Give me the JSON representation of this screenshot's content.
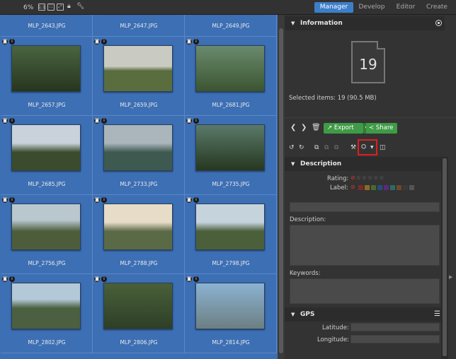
{
  "toolbar": {
    "zoom": "6%"
  },
  "tabs": [
    "Manager",
    "Develop",
    "Editor",
    "Create"
  ],
  "grid": {
    "files": [
      "MLP_2643.JPG",
      "MLP_2647.JPG",
      "MLP_2649.JPG",
      "MLP_2657.JPG",
      "MLP_2659.JPG",
      "MLP_2681.JPG",
      "MLP_2685.JPG",
      "MLP_2733.JPG",
      "MLP_2735.JPG",
      "MLP_2756.JPG",
      "MLP_2788.JPG",
      "MLP_2798.JPG",
      "MLP_2802.JPG",
      "MLP_2806.JPG",
      "MLP_2814.JPG"
    ]
  },
  "information": {
    "title": "Information",
    "count": "19",
    "selected": "Selected items: 19 (90.5 MB)"
  },
  "actions": {
    "export": "Export",
    "share": "Share"
  },
  "description": {
    "title": "Description",
    "rating_label": "Rating:",
    "label_label": "Label:",
    "description_label": "Description:",
    "keywords_label": "Keywords:"
  },
  "gps": {
    "title": "GPS",
    "latitude": "Latitude:",
    "longitude": "Longitude:"
  },
  "colors": {
    "accent": "#3d7ec9",
    "grid_bg": "#3d6fb5",
    "export_green": "#3f9b46",
    "highlight": "#e41c1c"
  },
  "label_colors": [
    "#7a2a2a",
    "#8a6a2a",
    "#4a6a2a",
    "#2a4a7a",
    "#5a2a7a",
    "#2a6a6a",
    "#6a4a2a",
    "#3a3a3a",
    "#555555"
  ]
}
